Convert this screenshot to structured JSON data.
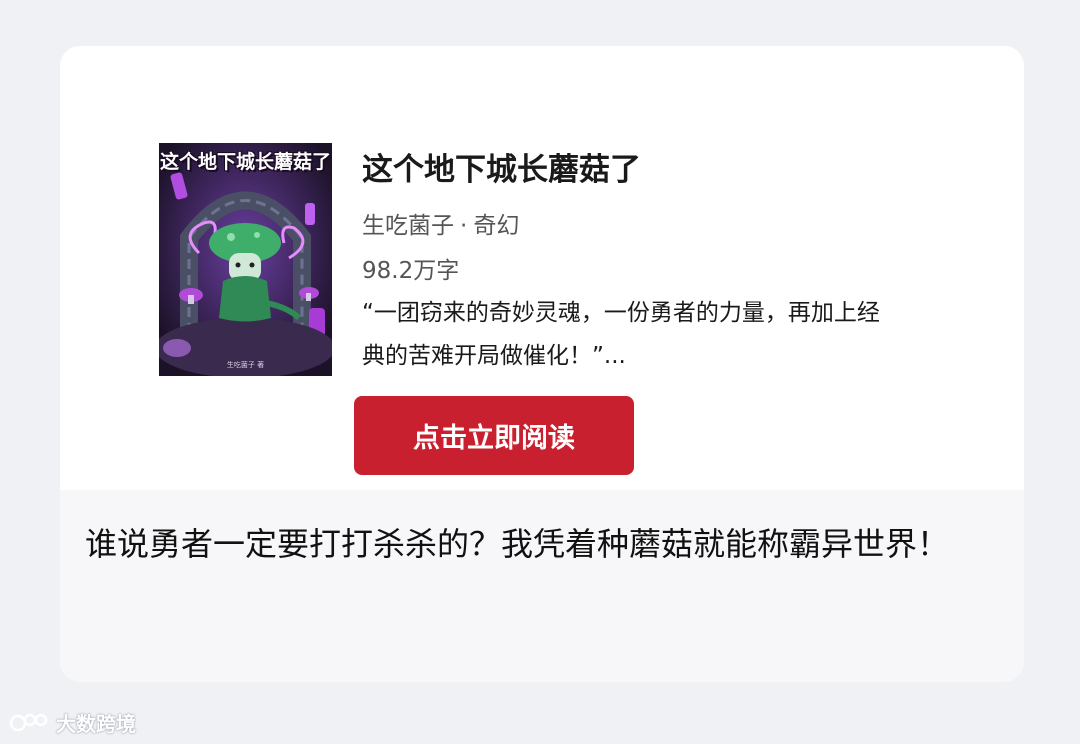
{
  "book": {
    "cover_title": "这个地下城长蘑菇了",
    "cover_author": "生吃菌子 著",
    "title": "这个地下城长蘑菇了",
    "author": "生吃菌子",
    "separator": "·",
    "genre": "奇幻",
    "word_count": "98.2万字",
    "blurb": "“一团窃来的奇妙灵魂，一份勇者的力量，再加上经典的苦难开局做催化！”..."
  },
  "read_button": {
    "label": "点击立即阅读",
    "color": "#c9202f"
  },
  "tagline": "谁说勇者一定要打打杀杀的？我凭着种蘑菇就能称霸异世界！",
  "watermark": {
    "text": "大数跨境",
    "icon": "brand-logo-icon"
  }
}
